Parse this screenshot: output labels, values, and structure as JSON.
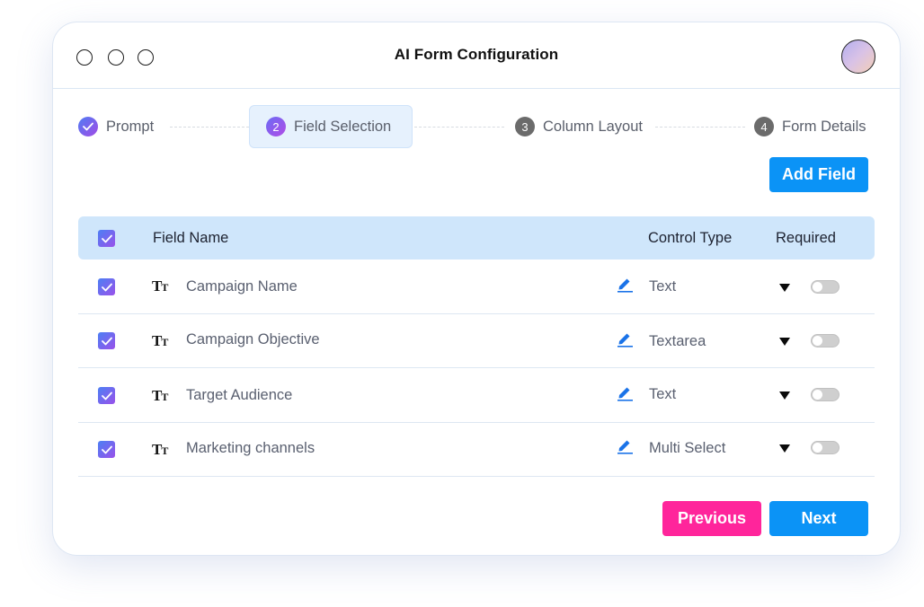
{
  "window": {
    "title": "AI Form Configuration"
  },
  "stepper": {
    "steps": [
      {
        "number": "",
        "label": "Prompt",
        "state": "done"
      },
      {
        "number": "2",
        "label": "Field Selection",
        "state": "current"
      },
      {
        "number": "3",
        "label": "Column Layout",
        "state": "todo"
      },
      {
        "number": "4",
        "label": "Form Details",
        "state": "todo"
      }
    ]
  },
  "toolbar": {
    "add_field_label": "Add Field"
  },
  "table": {
    "headers": {
      "field_name": "Field Name",
      "control_type": "Control Type",
      "required": "Required"
    },
    "rows": [
      {
        "name": "Campaign Name",
        "control_type": "Text",
        "selected": true,
        "required": false
      },
      {
        "name": "Campaign Objective",
        "control_type": "Textarea",
        "selected": true,
        "required": false
      },
      {
        "name": "Target Audience",
        "control_type": "Text",
        "selected": true,
        "required": false
      },
      {
        "name": "Marketing channels",
        "control_type": "Multi Select",
        "selected": true,
        "required": false
      }
    ]
  },
  "footer": {
    "previous_label": "Previous",
    "next_label": "Next"
  },
  "colors": {
    "primary": "#0b93f6",
    "pink": "#ff259b",
    "header_bg": "#cfe6fb"
  }
}
